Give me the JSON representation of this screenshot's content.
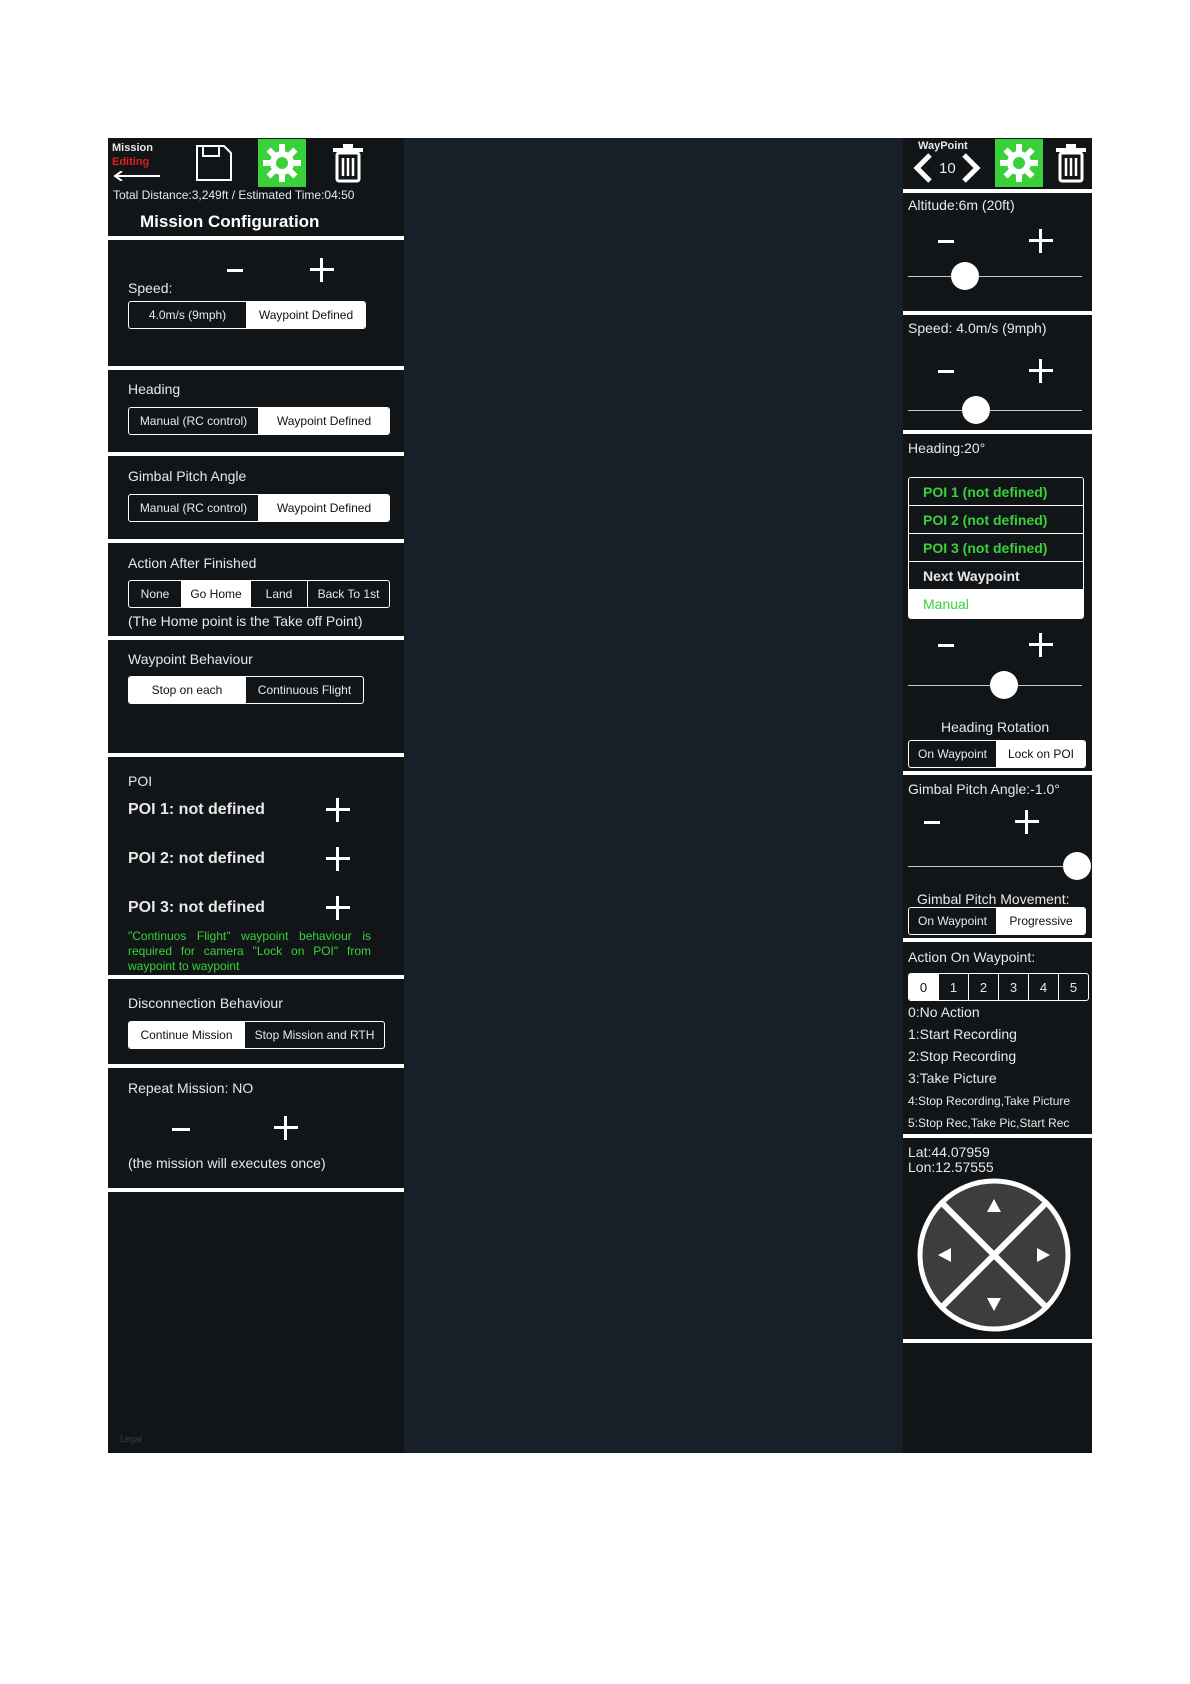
{
  "colors": {
    "accent_green": "#39d13a",
    "editing_red": "#e0201a",
    "panel": "#121517",
    "canvas": "#172029"
  },
  "left": {
    "header": {
      "mission": "Mission",
      "editing": "Editing",
      "summary": "Total Distance:3,249ft / Estimated Time:04:50",
      "title": "Mission Configuration"
    },
    "speed": {
      "label": "Speed:",
      "options": [
        "4.0m/s (9mph)",
        "Waypoint Defined"
      ],
      "selected": 1
    },
    "heading": {
      "label": "Heading",
      "options": [
        "Manual (RC control)",
        "Waypoint Defined"
      ],
      "selected": 1
    },
    "gimbal": {
      "label": "Gimbal Pitch Angle",
      "options": [
        "Manual (RC control)",
        "Waypoint Defined"
      ],
      "selected": 1
    },
    "action": {
      "label": "Action After Finished",
      "options": [
        "None",
        "Go Home",
        "Land",
        "Back To 1st"
      ],
      "selected": 1,
      "note": "(The Home point is the Take off Point)"
    },
    "wp_behaviour": {
      "label": "Waypoint Behaviour",
      "options": [
        "Stop on each",
        "Continuous Flight"
      ],
      "selected": 0
    },
    "poi": {
      "label": "POI",
      "items": [
        "POI 1: not defined",
        "POI 2: not defined",
        "POI 3: not defined"
      ],
      "note": "\"Continuos Flight\" waypoint behaviour is required for camera \"Lock on POI\" from waypoint to waypoint"
    },
    "disconnect": {
      "label": "Disconnection Behaviour",
      "options": [
        "Continue Mission",
        "Stop Mission and RTH"
      ],
      "selected": 0
    },
    "repeat": {
      "label": "Repeat Mission: NO",
      "note": "(the mission will executes once)"
    },
    "footer": "Legal"
  },
  "right": {
    "header": {
      "title": "WayPoint",
      "number": "10"
    },
    "altitude": {
      "label": "Altitude:6m (20ft)",
      "level": 0.33
    },
    "speed": {
      "label": "Speed: 4.0m/s (9mph)",
      "level": 0.39
    },
    "heading": {
      "label": "Heading:20°",
      "poi_options": [
        "POI 1 (not defined)",
        "POI 2 (not defined)",
        "POI 3 (not defined)",
        "Next Waypoint",
        "Manual"
      ],
      "level": 0.55
    },
    "rotation": {
      "label": "Heading Rotation",
      "options": [
        "On Waypoint",
        "Lock on POI"
      ],
      "selected": 1
    },
    "gimbal": {
      "label": "Gimbal Pitch Angle:-1.0°",
      "level": 0.97
    },
    "movement": {
      "label": "Gimbal Pitch Movement:",
      "options": [
        "On Waypoint",
        "Progressive"
      ],
      "selected": 1
    },
    "action": {
      "label": "Action On Waypoint:",
      "numbers": [
        "0",
        "1",
        "2",
        "3",
        "4",
        "5"
      ],
      "selected": 0,
      "legend": [
        "0:No Action",
        "1:Start Recording",
        "2:Stop Recording",
        "3:Take Picture",
        "4:Stop Recording,Take Picture",
        "5:Stop Rec,Take Pic,Start Rec"
      ]
    },
    "coords": {
      "lat": "Lat:44.07959",
      "lon": "Lon:12.57555"
    }
  }
}
